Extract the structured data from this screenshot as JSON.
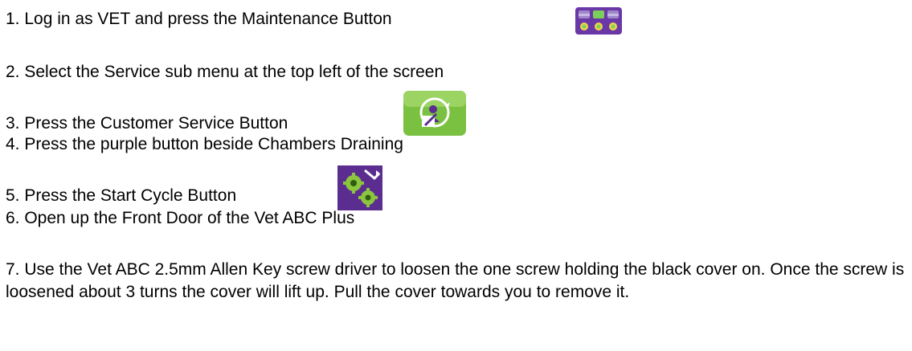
{
  "instructions": {
    "steps": [
      {
        "text": "1. Log in as VET and press the Maintenance Button",
        "icon": "maintenance-icon"
      },
      {
        "text": "2. Select the Service sub menu at the top left of the screen"
      },
      {
        "text": "3. Press the Customer Service Button",
        "icon": "customer-service-icon"
      },
      {
        "text": "4. Press the purple button beside Chambers Draining"
      },
      {
        "text": "5. Press the Start Cycle Button",
        "icon": "start-cycle-icon"
      },
      {
        "text": "6. Open up the Front Door of the Vet ABC Plus"
      },
      {
        "text": "7. Use the Vet ABC 2.5mm Allen Key screw driver to loosen the one screw holding the black cover on. Once the screw is loosened about 3 turns the cover will lift up. Pull the cover towards you to remove it."
      }
    ]
  },
  "colors": {
    "maintenance_bg": "#6a38a6",
    "maintenance_bar_green": "#7bd05a",
    "maintenance_dot": "#f0d24a",
    "customer_service_green": "#7ac142",
    "start_cycle_purple": "#5b2d91",
    "start_cycle_gear": "#8cc63f"
  }
}
